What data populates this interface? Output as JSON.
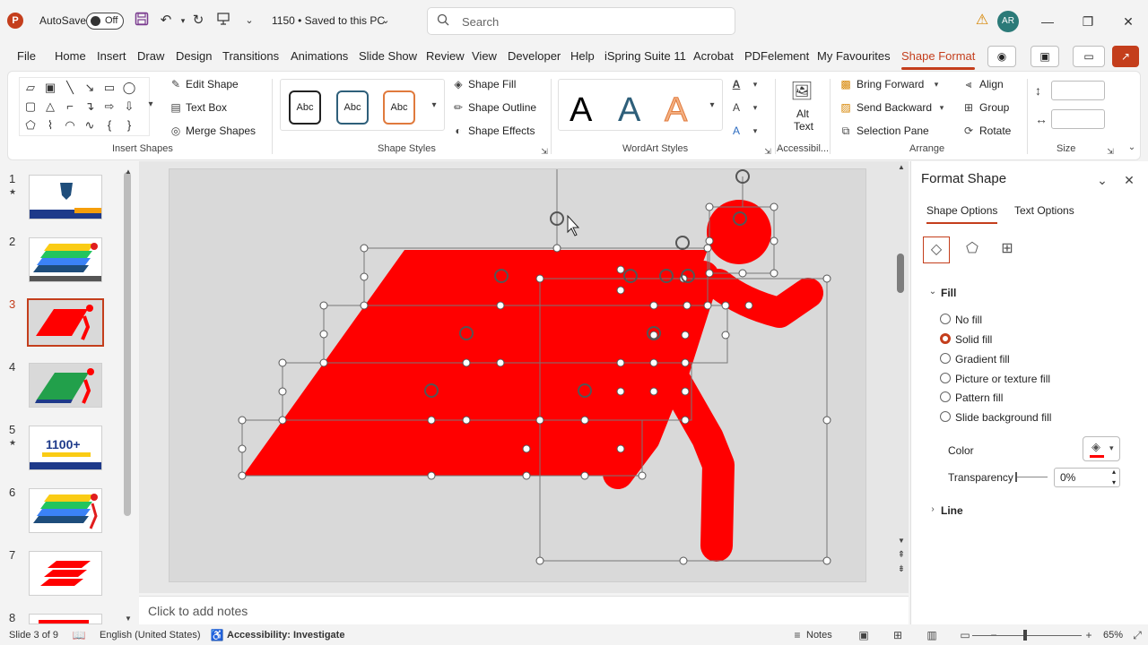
{
  "titlebar": {
    "autosave_label": "AutoSave",
    "autosave_state": "Off",
    "doc_title": "1150 • Saved to this PC",
    "search_placeholder": "Search",
    "avatar_initials": "AR"
  },
  "menu": {
    "tabs": [
      "File",
      "Home",
      "Insert",
      "Draw",
      "Design",
      "Transitions",
      "Animations",
      "Slide Show",
      "Review",
      "View",
      "Developer",
      "Help",
      "iSpring Suite 11",
      "Acrobat",
      "PDFelement",
      "My Favourites",
      "Shape Format"
    ],
    "active_tab": "Shape Format"
  },
  "ribbon": {
    "insert_shapes": {
      "label": "Insert Shapes",
      "edit_shape": "Edit Shape",
      "text_box": "Text Box",
      "merge_shapes": "Merge Shapes"
    },
    "shape_styles": {
      "label": "Shape Styles",
      "styles": [
        "Abc",
        "Abc",
        "Abc"
      ],
      "fill": "Shape Fill",
      "outline": "Shape Outline",
      "effects": "Shape Effects"
    },
    "wordart": {
      "label": "WordArt Styles",
      "letters": [
        "A",
        "A",
        "A"
      ]
    },
    "accessibility": {
      "label": "Accessibil...",
      "alt_text": "Alt Text"
    },
    "arrange": {
      "label": "Arrange",
      "bring_forward": "Bring Forward",
      "send_backward": "Send Backward",
      "selection_pane": "Selection Pane",
      "align": "Align",
      "group": "Group",
      "rotate": "Rotate"
    },
    "size": {
      "label": "Size"
    }
  },
  "slides": [
    {
      "num": "1",
      "star": true
    },
    {
      "num": "2",
      "star": false
    },
    {
      "num": "3",
      "star": false,
      "active": true
    },
    {
      "num": "4",
      "star": false
    },
    {
      "num": "5",
      "star": true,
      "text": "1100+"
    },
    {
      "num": "6",
      "star": false
    },
    {
      "num": "7",
      "star": false
    },
    {
      "num": "8",
      "star": false
    }
  ],
  "notes_placeholder": "Click to add notes",
  "format_pane": {
    "title": "Format Shape",
    "tabs": [
      "Shape Options",
      "Text Options"
    ],
    "active_tab": "Shape Options",
    "fill_section": "Fill",
    "fill_options": [
      "No fill",
      "Solid fill",
      "Gradient fill",
      "Picture or texture fill",
      "Pattern fill",
      "Slide background fill"
    ],
    "selected_fill": "Solid fill",
    "color_label": "Color",
    "transparency_label": "Transparency",
    "transparency_value": "0%",
    "line_section": "Line"
  },
  "status": {
    "slide_info": "Slide 3 of 9",
    "language": "English (United States)",
    "accessibility": "Accessibility: Investigate",
    "notes": "Notes",
    "zoom": "65%"
  },
  "colors": {
    "accent": "#c43e1c",
    "shape_red": "#ff0000"
  }
}
